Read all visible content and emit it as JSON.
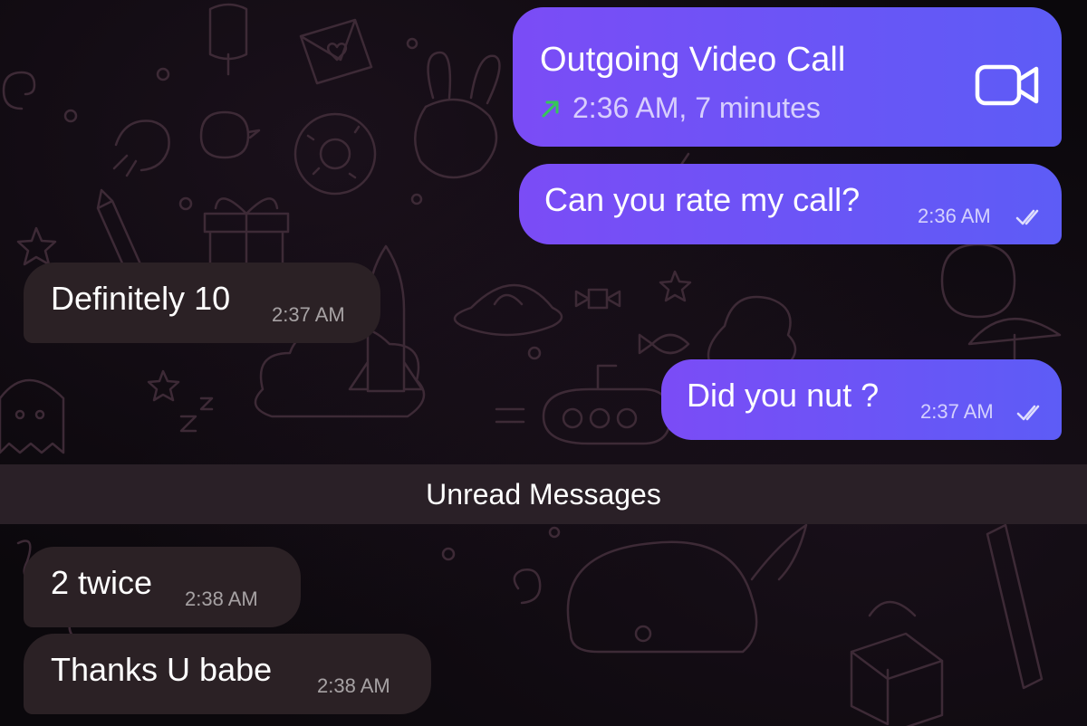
{
  "call": {
    "title": "Outgoing Video Call",
    "detail": "2:36 AM, 7 minutes",
    "direction_icon": "outgoing-arrow-icon",
    "call_icon": "video-camera-icon",
    "arrow_color": "#35c759"
  },
  "messages": [
    {
      "text": "Can you rate my call?",
      "time": "2:36 AM",
      "direction": "outgoing",
      "status": "read"
    },
    {
      "text": "Definitely 10",
      "time": "2:37 AM",
      "direction": "incoming"
    },
    {
      "text": "Did you nut ?",
      "time": "2:37 AM",
      "direction": "outgoing",
      "status": "read"
    },
    {
      "text": "2 twice",
      "time": "2:38 AM",
      "direction": "incoming"
    },
    {
      "text": "Thanks U babe",
      "time": "2:38 AM",
      "direction": "incoming"
    }
  ],
  "divider": {
    "label": "Unread Messages"
  },
  "colors": {
    "outgoing_bubble_start": "#7b4cf6",
    "outgoing_bubble_end": "#5d5cf6",
    "incoming_bubble": "#2b2125",
    "divider_background": "#2a2027",
    "background": "#0b080c"
  }
}
